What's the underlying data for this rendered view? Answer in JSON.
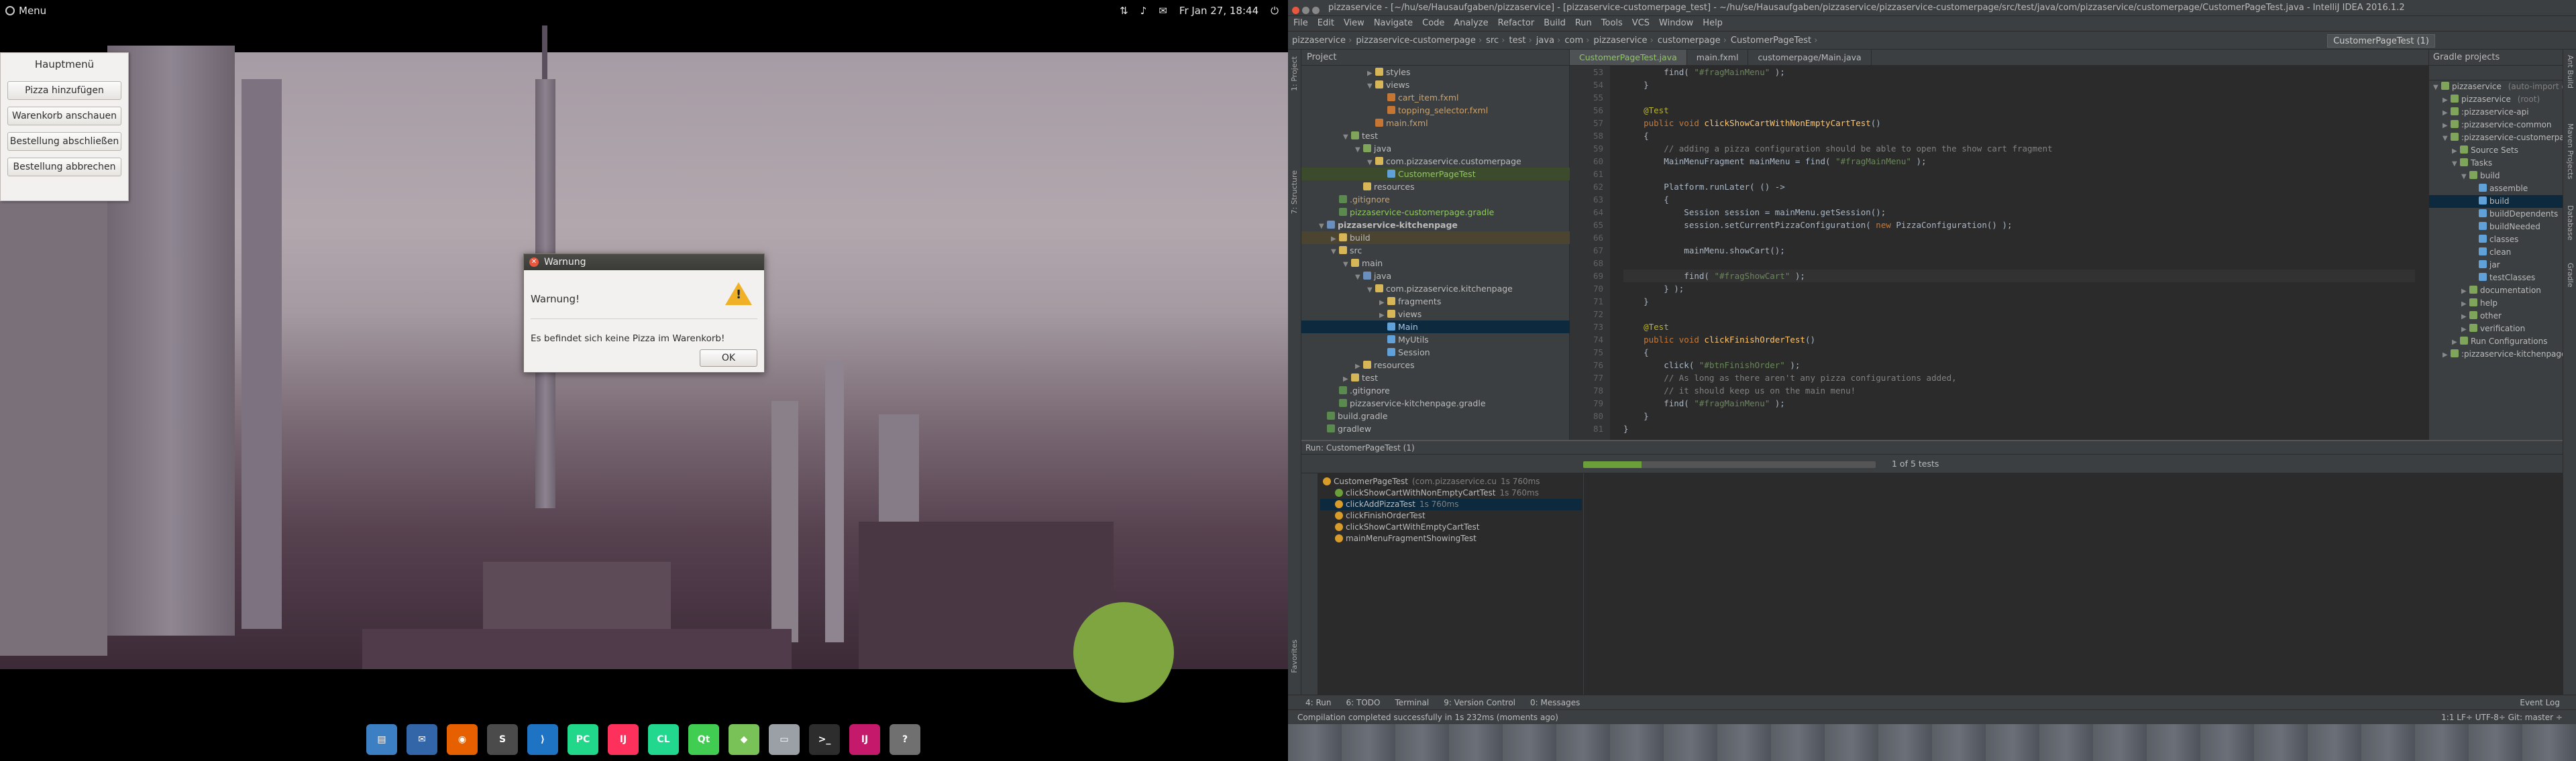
{
  "desktop": {
    "menu_label": "Menu",
    "clock": "Fr Jan 27, 18:44",
    "hauptmenu": {
      "title": "Hauptmenü",
      "buttons": [
        "Pizza hinzufügen",
        "Warenkorb anschauen",
        "Bestellung abschließen",
        "Bestellung abbrechen"
      ]
    },
    "dialog": {
      "title": "Warnung",
      "heading": "Warnung!",
      "message": "Es befindet sich keine Pizza im Warenkorb!",
      "ok": "OK"
    },
    "dock_icons": [
      {
        "name": "files-icon",
        "color": "#3c7fc2",
        "glyph": "▤"
      },
      {
        "name": "thunderbird-icon",
        "color": "#3366a8",
        "glyph": "✉"
      },
      {
        "name": "firefox-icon",
        "color": "#e66000",
        "glyph": "◉"
      },
      {
        "name": "sublime-icon",
        "color": "#4b4b4b",
        "glyph": "S"
      },
      {
        "name": "vscode-icon",
        "color": "#1e73c3",
        "glyph": "⟩"
      },
      {
        "name": "pycharm-icon",
        "color": "#21d789",
        "glyph": "PC"
      },
      {
        "name": "intellij-icon",
        "color": "#fe315d",
        "glyph": "IJ"
      },
      {
        "name": "clion-icon",
        "color": "#22d88f",
        "glyph": "CL"
      },
      {
        "name": "qtcreator-icon",
        "color": "#41cd52",
        "glyph": "Qt"
      },
      {
        "name": "android-studio-icon",
        "color": "#78c257",
        "glyph": "◆"
      },
      {
        "name": "file-manager-icon",
        "color": "#9aa0a6",
        "glyph": "▭"
      },
      {
        "name": "terminal-icon",
        "color": "#2d2d2d",
        "glyph": ">_"
      },
      {
        "name": "intellij-running-icon",
        "color": "#c51a6b",
        "glyph": "IJ"
      },
      {
        "name": "help-icon",
        "color": "#707070",
        "glyph": "?"
      }
    ]
  },
  "ide": {
    "title": "pizzaservice - [~/hu/se/Hausaufgaben/pizzaservice] - [pizzaservice-customerpage_test] - ~/hu/se/Hausaufgaben/pizzaservice/pizzaservice-customerpage/src/test/java/com/pizzaservice/customerpage/CustomerPageTest.java - IntelliJ IDEA 2016.1.2",
    "menu": [
      "File",
      "Edit",
      "View",
      "Navigate",
      "Code",
      "Analyze",
      "Refactor",
      "Build",
      "Run",
      "Tools",
      "VCS",
      "Window",
      "Help"
    ],
    "breadcrumbs": [
      "pizzaservice",
      "pizzaservice-customerpage",
      "src",
      "test",
      "java",
      "com",
      "pizzaservice",
      "customerpage",
      "CustomerPageTest"
    ],
    "run_config": "CustomerPageTest (1)",
    "project_header": "Project",
    "project_tree": [
      {
        "indent": 5,
        "arrow": "▶",
        "icon": "fold",
        "label": "styles"
      },
      {
        "indent": 5,
        "arrow": "▼",
        "icon": "fold",
        "label": "views"
      },
      {
        "indent": 6,
        "arrow": "",
        "icon": "file-x",
        "label": "cart_item.fxml",
        "cls": "orange"
      },
      {
        "indent": 6,
        "arrow": "",
        "icon": "file-x",
        "label": "topping_selector.fxml",
        "cls": "orange"
      },
      {
        "indent": 5,
        "arrow": "",
        "icon": "file-x",
        "label": "main.fxml",
        "cls": "orange"
      },
      {
        "indent": 3,
        "arrow": "▼",
        "icon": "fold-g",
        "label": "test"
      },
      {
        "indent": 4,
        "arrow": "▼",
        "icon": "fold-g",
        "label": "java"
      },
      {
        "indent": 5,
        "arrow": "▼",
        "icon": "fold",
        "label": "com.pizzaservice.customerpage"
      },
      {
        "indent": 6,
        "arrow": "",
        "icon": "file-j",
        "label": "CustomerPageTest",
        "cls": "green",
        "hl": true
      },
      {
        "indent": 4,
        "arrow": "",
        "icon": "fold",
        "label": "resources"
      },
      {
        "indent": 2,
        "arrow": "",
        "icon": "file-g",
        "label": ".gitignore",
        "cls": "orange"
      },
      {
        "indent": 2,
        "arrow": "",
        "icon": "file-g",
        "label": "pizzaservice-customerpage.gradle",
        "cls": "green"
      },
      {
        "indent": 1,
        "arrow": "▼",
        "icon": "fold-b",
        "label": "pizzaservice-kitchenpage",
        "bold": true
      },
      {
        "indent": 2,
        "arrow": "▶",
        "icon": "fold",
        "label": "build",
        "hl2": true
      },
      {
        "indent": 2,
        "arrow": "▼",
        "icon": "fold",
        "label": "src"
      },
      {
        "indent": 3,
        "arrow": "▼",
        "icon": "fold",
        "label": "main"
      },
      {
        "indent": 4,
        "arrow": "▼",
        "icon": "fold-b",
        "label": "java"
      },
      {
        "indent": 5,
        "arrow": "▼",
        "icon": "fold",
        "label": "com.pizzaservice.kitchenpage"
      },
      {
        "indent": 6,
        "arrow": "▶",
        "icon": "fold",
        "label": "fragments"
      },
      {
        "indent": 6,
        "arrow": "▶",
        "icon": "fold",
        "label": "views"
      },
      {
        "indent": 6,
        "arrow": "",
        "icon": "file-j",
        "label": "Main",
        "sel": true,
        "cls": "blue"
      },
      {
        "indent": 6,
        "arrow": "",
        "icon": "file-j",
        "label": "MyUtils"
      },
      {
        "indent": 6,
        "arrow": "",
        "icon": "file-j",
        "label": "Session"
      },
      {
        "indent": 4,
        "arrow": "▶",
        "icon": "fold",
        "label": "resources"
      },
      {
        "indent": 3,
        "arrow": "▶",
        "icon": "fold",
        "label": "test"
      },
      {
        "indent": 2,
        "arrow": "",
        "icon": "file-g",
        "label": ".gitignore"
      },
      {
        "indent": 2,
        "arrow": "",
        "icon": "file-g",
        "label": "pizzaservice-kitchenpage.gradle"
      },
      {
        "indent": 1,
        "arrow": "",
        "icon": "file-g",
        "label": "build.gradle"
      },
      {
        "indent": 1,
        "arrow": "",
        "icon": "file-g",
        "label": "gradlew"
      }
    ],
    "editor_tabs": [
      {
        "label": "CustomerPageTest.java",
        "active": true
      },
      {
        "label": "main.fxml",
        "active": false
      },
      {
        "label": "customerpage/Main.java",
        "active": false
      }
    ],
    "code_start_line": 53,
    "code_lines": [
      [
        [
          "cl",
          "        find( "
        ],
        [
          "st",
          "\"#fragMainMenu\""
        ],
        [
          "cl",
          " );"
        ]
      ],
      [
        [
          "cl",
          "    }"
        ]
      ],
      [
        [
          "cl",
          ""
        ]
      ],
      [
        [
          "an",
          "    @Test"
        ]
      ],
      [
        [
          "kw",
          "    public void "
        ],
        [
          "fn",
          "clickShowCartWithNonEmptyCartTest"
        ],
        [
          "cl",
          "()"
        ]
      ],
      [
        [
          "cl",
          "    {"
        ]
      ],
      [
        [
          "cm",
          "        // adding a pizza configuration should be able to open the show cart fragment"
        ]
      ],
      [
        [
          "cl",
          "        MainMenuFragment mainMenu = find( "
        ],
        [
          "st",
          "\"#fragMainMenu\""
        ],
        [
          "cl",
          " );"
        ]
      ],
      [
        [
          "cl",
          ""
        ]
      ],
      [
        [
          "cl",
          "        Platform.runLater( () ->"
        ]
      ],
      [
        [
          "cl",
          "        {"
        ]
      ],
      [
        [
          "cl",
          "            Session session = mainMenu.getSession();"
        ]
      ],
      [
        [
          "cl",
          "            session.setCurrentPizzaConfiguration( "
        ],
        [
          "kw",
          "new "
        ],
        [
          "cl",
          "PizzaConfiguration() );"
        ]
      ],
      [
        [
          "cl",
          ""
        ]
      ],
      [
        [
          "cl",
          "            mainMenu.showCart();"
        ]
      ],
      [
        [
          "cl",
          ""
        ]
      ],
      [
        [
          "cl",
          "            find( "
        ],
        [
          "st",
          "\"#fragShowCart\""
        ],
        [
          "cl",
          " );"
        ]
      ],
      [
        [
          "cl",
          "        } );"
        ]
      ],
      [
        [
          "cl",
          "    }"
        ]
      ],
      [
        [
          "cl",
          ""
        ]
      ],
      [
        [
          "an",
          "    @Test"
        ]
      ],
      [
        [
          "kw",
          "    public void "
        ],
        [
          "fn",
          "clickFinishOrderTest"
        ],
        [
          "cl",
          "()"
        ]
      ],
      [
        [
          "cl",
          "    {"
        ]
      ],
      [
        [
          "cl",
          "        click( "
        ],
        [
          "st",
          "\"#btnFinishOrder\""
        ],
        [
          "cl",
          " );"
        ]
      ],
      [
        [
          "cm",
          "        // As long as there aren't any pizza configurations added,"
        ]
      ],
      [
        [
          "cm",
          "        // it should keep us on the main menu!"
        ]
      ],
      [
        [
          "cl",
          "        find( "
        ],
        [
          "st",
          "\"#fragMainMenu\""
        ],
        [
          "cl",
          " );"
        ]
      ],
      [
        [
          "cl",
          "    }"
        ]
      ],
      [
        [
          "cl",
          "}"
        ]
      ]
    ],
    "gradle_header": "Gradle projects",
    "gradle_tree": [
      {
        "indent": 0,
        "arrow": "▼",
        "label": "pizzaservice",
        "suffix": " (auto-import enabled)"
      },
      {
        "indent": 1,
        "arrow": "▶",
        "label": "pizzaservice",
        "suffix": " (root)"
      },
      {
        "indent": 1,
        "arrow": "▶",
        "label": ":pizzaservice-api",
        "suffix": ""
      },
      {
        "indent": 1,
        "arrow": "▶",
        "label": ":pizzaservice-common",
        "suffix": ""
      },
      {
        "indent": 1,
        "arrow": "▼",
        "label": ":pizzaservice-customerpage",
        "suffix": ""
      },
      {
        "indent": 2,
        "arrow": "▶",
        "label": "Source Sets",
        "suffix": ""
      },
      {
        "indent": 2,
        "arrow": "▼",
        "label": "Tasks",
        "suffix": ""
      },
      {
        "indent": 3,
        "arrow": "▼",
        "label": "build",
        "suffix": ""
      },
      {
        "indent": 4,
        "arrow": "",
        "label": "assemble",
        "suffix": ""
      },
      {
        "indent": 4,
        "arrow": "",
        "label": "build",
        "suffix": "",
        "sel": true
      },
      {
        "indent": 4,
        "arrow": "",
        "label": "buildDependents",
        "suffix": ""
      },
      {
        "indent": 4,
        "arrow": "",
        "label": "buildNeeded",
        "suffix": ""
      },
      {
        "indent": 4,
        "arrow": "",
        "label": "classes",
        "suffix": ""
      },
      {
        "indent": 4,
        "arrow": "",
        "label": "clean",
        "suffix": ""
      },
      {
        "indent": 4,
        "arrow": "",
        "label": "jar",
        "suffix": ""
      },
      {
        "indent": 4,
        "arrow": "",
        "label": "testClasses",
        "suffix": ""
      },
      {
        "indent": 3,
        "arrow": "▶",
        "label": "documentation",
        "suffix": ""
      },
      {
        "indent": 3,
        "arrow": "▶",
        "label": "help",
        "suffix": ""
      },
      {
        "indent": 3,
        "arrow": "▶",
        "label": "other",
        "suffix": ""
      },
      {
        "indent": 3,
        "arrow": "▶",
        "label": "verification",
        "suffix": ""
      },
      {
        "indent": 2,
        "arrow": "▶",
        "label": "Run Configurations",
        "suffix": ""
      },
      {
        "indent": 1,
        "arrow": "▶",
        "label": ":pizzaservice-kitchenpage",
        "suffix": ""
      }
    ],
    "run": {
      "header": "Run",
      "config": "CustomerPageTest (1)",
      "progress_fraction": 0.2,
      "progress_text": "1 of 5 tests",
      "tests": [
        {
          "label": "CustomerPageTest",
          "detail": "(com.pizzaservice.cu",
          "dur": "1s 760ms",
          "status": "run",
          "root": true
        },
        {
          "label": "clickShowCartWithNonEmptyCartTest",
          "detail": "",
          "dur": "1s 760ms",
          "status": "ok"
        },
        {
          "label": "clickAddPizzaTest",
          "detail": "",
          "dur": "1s 760ms",
          "status": "run",
          "sel": true
        },
        {
          "label": "clickFinishOrderTest",
          "detail": "",
          "dur": "",
          "status": "run"
        },
        {
          "label": "clickShowCartWithEmptyCartTest",
          "detail": "",
          "dur": "",
          "status": "run"
        },
        {
          "label": "mainMenuFragmentShowingTest",
          "detail": "",
          "dur": "",
          "status": "run"
        }
      ]
    },
    "bottom_tabs": [
      "4: Run",
      "6: TODO",
      "Terminal",
      "9: Version Control",
      "0: Messages"
    ],
    "event_log": "Event Log",
    "status": "Compilation completed successfully in 1s 232ms (moments ago)",
    "status_right": "1:1  LF÷  UTF-8÷  Git: master ÷",
    "left_tools": [
      "1: Project",
      "7: Structure",
      "Favorites"
    ],
    "right_tools": [
      "Ant Build",
      "Maven Projects",
      "Database",
      "Gradle"
    ]
  }
}
